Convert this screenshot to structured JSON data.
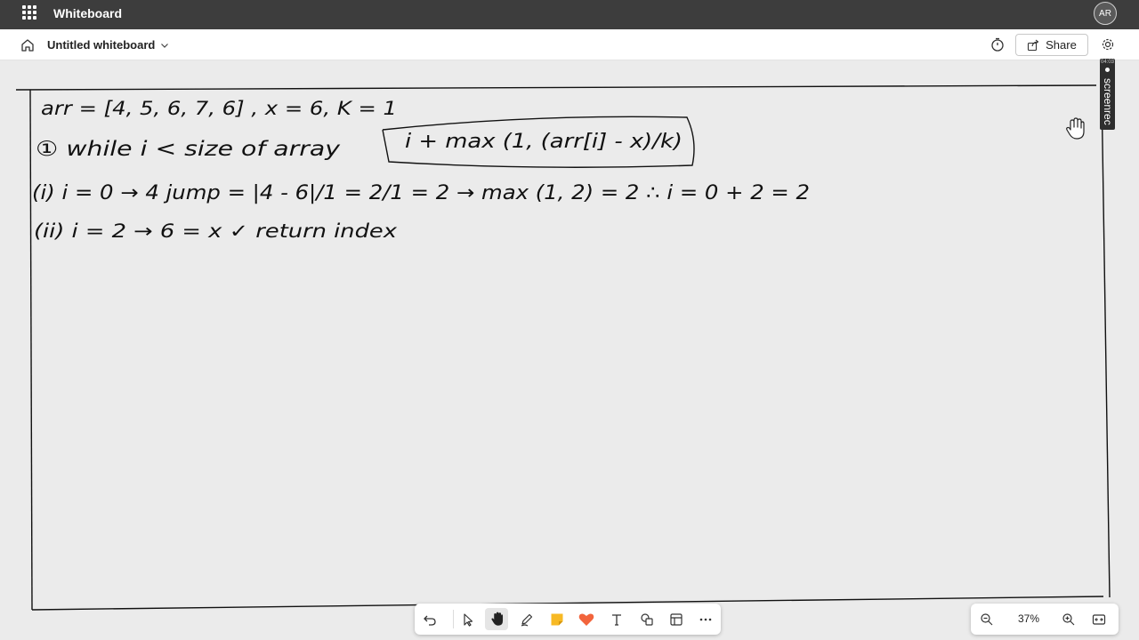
{
  "app": {
    "title": "Whiteboard",
    "user_initials": "AR"
  },
  "document": {
    "title": "Untitled whiteboard"
  },
  "toolbar": {
    "share_label": "Share"
  },
  "zoom": {
    "level": "37%"
  },
  "overlay": {
    "recorder_label": "screenrec",
    "recorder_time": "04:03"
  },
  "tools": [
    {
      "name": "undo-icon"
    },
    {
      "name": "select-pointer-icon"
    },
    {
      "name": "hand-pan-icon"
    },
    {
      "name": "pen-icon"
    },
    {
      "name": "sticky-note-icon"
    },
    {
      "name": "reaction-heart-icon"
    },
    {
      "name": "text-icon"
    },
    {
      "name": "shapes-icon"
    },
    {
      "name": "template-icon"
    },
    {
      "name": "more-icon"
    }
  ],
  "ink_lines": [
    "arr = [4, 5, 6, 7, 6] , x = 6, K = 1",
    "① while i < size of array",
    "i + max (1, (arr[i] - x)/k)",
    "(i) i = 0 → 4   jump = |4 - 6|/1 = 2/1 = 2 → max (1, 2) = 2 ∴ i = 0 + 2 = 2",
    "(ii) i = 2 → 6 = x ✓ return index"
  ],
  "colors": {
    "titlebar": "#3d3d3d",
    "canvas": "#ebebeb",
    "ink": "#111111",
    "sticky": "#f7b924",
    "heart": "#f2643c"
  }
}
